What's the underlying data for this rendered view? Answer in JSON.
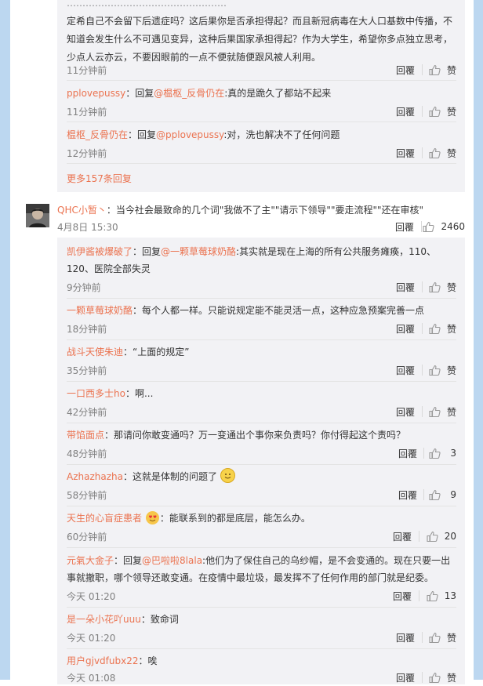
{
  "top_tail": {
    "line1_prefix": "定希自己不会留下后遗症吗？这后果你是否承担得起？而且新冠病毒在大人口基数中传播，不",
    "line2": "知道会发生什么不可遇见变异，这种后果国家承担得起？作为大学生，希望你多点独立思考，",
    "line3": "少点人云亦云，不要因眼前的一点不便就随便跟风被人利用。",
    "time": "11分钟前",
    "reply": "回覆",
    "likes": "赞"
  },
  "top_replies": [
    {
      "user": "pplovepussy",
      "sep": "：回复",
      "mention": "@榅枢_反骨仍在",
      "text": ":真的是跪久了都站不起来",
      "time": "11分钟前",
      "reply": "回覆",
      "likes": "赞"
    },
    {
      "user": "榅枢_反骨仍在",
      "sep": "：回复",
      "mention": "@pplovepussy",
      "text": ":对，洗也解决不了任何问题",
      "time": "12分钟前",
      "reply": "回覆",
      "likes": "赞"
    }
  ],
  "more_link": "更多157条回复",
  "main_comment": {
    "user": "QHC小暂丶",
    "text": "：当今社会最致命的几个词\"我做不了主\"\"请示下领导\"\"要走流程\"\"还在审核\"",
    "date": "4月8日 15:30",
    "reply": "回覆",
    "likes": "2460"
  },
  "replies": [
    {
      "user": "凯伊酱被爆破了",
      "sep": "：回复",
      "mention": "@一颗草莓球奶酪",
      "text": ":其实就是现在上海的所有公共服务瘫痪，110、",
      "text2": "120、医院全部失灵",
      "time": "9分钟前",
      "reply": "回覆",
      "likes": "赞"
    },
    {
      "user": "一颗草莓球奶酪",
      "sep": "",
      "mention": "",
      "text": "：每个人都一样。只能说规定能不能灵活一点，这种应急预案完善一点",
      "time": "18分钟前",
      "reply": "回覆",
      "likes": "赞"
    },
    {
      "user": "战斗天使朱迪",
      "sep": "",
      "mention": "",
      "text": "：“上面的规定”",
      "time": "35分钟前",
      "reply": "回覆",
      "likes": "赞"
    },
    {
      "user": "一口西多士ho",
      "sep": "",
      "mention": "",
      "text": "：啊...",
      "time": "42分钟前",
      "reply": "回覆",
      "likes": "赞"
    },
    {
      "user": "带馅面点",
      "sep": "",
      "mention": "",
      "text": "：那请问你敢变通吗？万一变通出个事你来负责吗？你付得起这个责吗？",
      "time": "48分钟前",
      "reply": "回覆",
      "likes": "3"
    },
    {
      "user": "Azhazhazha",
      "sep": "",
      "mention": "",
      "text": "：这就是体制的问题了",
      "time": "58分钟前",
      "reply": "回覆",
      "likes": "9"
    },
    {
      "user": "天生的心盲症患者",
      "sep": "",
      "mention": "",
      "text": "：能联系到的都是底层，能怎么办。",
      "time": "60分钟前",
      "reply": "回覆",
      "likes": "20"
    },
    {
      "user": "元氣大金子",
      "sep": "：回复",
      "mention": "@巴啦啦8lala",
      "text": ":他们为了保住自己的乌纱帽，是不会变通的。现在只要一出",
      "text2": "事就撤职，哪个领导还敢变通。在疫情中最垃圾，最发挥不了任何作用的部门就是纪委。",
      "time": "今天 01:20",
      "reply": "回覆",
      "likes": "13"
    },
    {
      "user": "是一朵小花吖uuu",
      "sep": "",
      "mention": "",
      "text": "：致命词",
      "time": "今天 01:20",
      "reply": "回覆",
      "likes": "赞"
    },
    {
      "user": "用户gjvdfubx22",
      "sep": "",
      "mention": "",
      "text": "：唉",
      "time": "今天 01:08",
      "reply": "回覆",
      "likes": "赞"
    }
  ],
  "colors": {
    "link": "#eb7350",
    "bg_thread": "#f2f2f5",
    "stripe": "#bcd7f0"
  }
}
